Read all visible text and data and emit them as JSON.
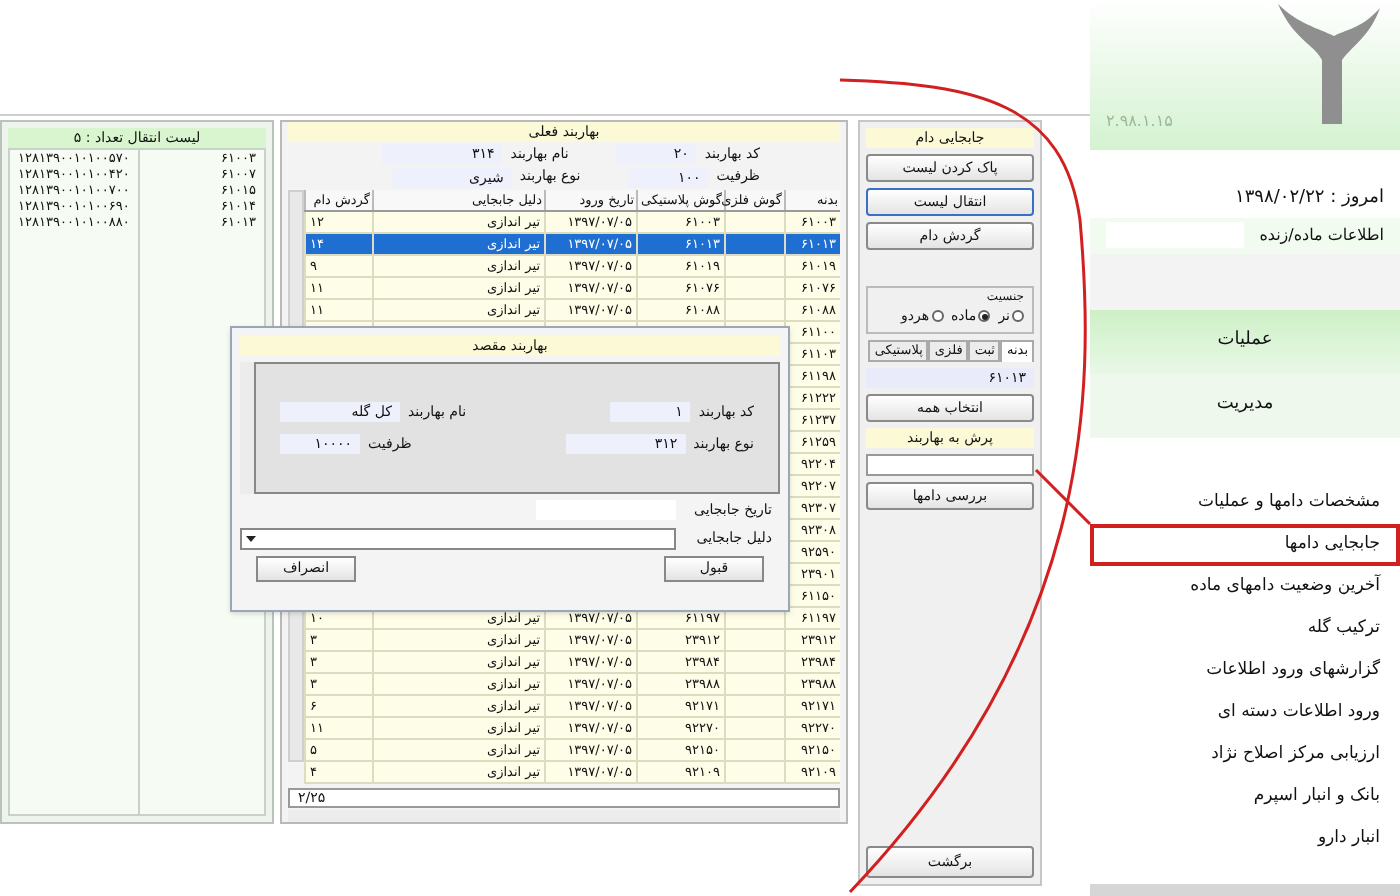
{
  "transfer_list": {
    "title": "لیست انتقال تعداد : ۵",
    "items": [
      {
        "tag": "۶۱۰۰۳",
        "code": "۱۲۸۱۳۹۰۰۱۰۱۰۰۵۷۰"
      },
      {
        "tag": "۶۱۰۰۷",
        "code": "۱۲۸۱۳۹۰۰۱۰۱۰۰۴۲۰"
      },
      {
        "tag": "۶۱۰۱۵",
        "code": "۱۲۸۱۳۹۰۰۱۰۱۰۰۷۰۰"
      },
      {
        "tag": "۶۱۰۱۴",
        "code": "۱۲۸۱۳۹۰۰۱۰۱۰۰۶۹۰"
      },
      {
        "tag": "۶۱۰۱۳",
        "code": "۱۲۸۱۳۹۰۰۱۰۱۰۰۸۸۰"
      }
    ]
  },
  "current_pen": {
    "title": "بهاربند فعلی",
    "fields": [
      {
        "label": "کد بهاربند",
        "value": "۲۰"
      },
      {
        "label": "نام بهاربند",
        "value": "۳۱۴"
      },
      {
        "label": "ظرفیت",
        "value": "۱۰۰"
      },
      {
        "label": "نوع بهاربند",
        "value": "شیری"
      }
    ],
    "table": {
      "columns": [
        "بدنه",
        "گوش فلزی",
        "گوش پلاستیکی",
        "تاریخ ورود",
        "دلیل جابجایی",
        "گردش دام"
      ],
      "rows": [
        {
          "tag": "۶۱۰۰۳",
          "ear_plastic": "۶۱۰۰۳",
          "entry_date": "۱۳۹۷/۰۷/۰۵",
          "reason": "تیر اندازی",
          "turnover": "۱۲",
          "selected": false
        },
        {
          "tag": "۶۱۰۱۳",
          "ear_plastic": "۶۱۰۱۳",
          "entry_date": "۱۳۹۷/۰۷/۰۵",
          "reason": "تیر اندازی",
          "turnover": "۱۴",
          "selected": true
        },
        {
          "tag": "۶۱۰۱۹",
          "ear_plastic": "۶۱۰۱۹",
          "entry_date": "۱۳۹۷/۰۷/۰۵",
          "reason": "تیر اندازی",
          "turnover": "۹",
          "selected": false
        },
        {
          "tag": "۶۱۰۷۶",
          "ear_plastic": "۶۱۰۷۶",
          "entry_date": "۱۳۹۷/۰۷/۰۵",
          "reason": "تیر اندازی",
          "turnover": "۱۱",
          "selected": false
        },
        {
          "tag": "۶۱۰۸۸",
          "ear_plastic": "۶۱۰۸۸",
          "entry_date": "۱۳۹۷/۰۷/۰۵",
          "reason": "تیر اندازی",
          "turnover": "۱۱",
          "selected": false
        },
        {
          "tag": "۶۱۱۰۰",
          "selected": false
        },
        {
          "tag": "۶۱۱۰۳",
          "selected": false
        },
        {
          "tag": "۶۱۱۹۸",
          "selected": false
        },
        {
          "tag": "۶۱۲۲۲",
          "selected": false
        },
        {
          "tag": "۶۱۲۳۷",
          "selected": false
        },
        {
          "tag": "۶۱۲۵۹",
          "selected": false
        },
        {
          "tag": "۹۲۲۰۴",
          "selected": false
        },
        {
          "tag": "۹۲۲۰۷",
          "selected": false
        },
        {
          "tag": "۹۲۳۰۷",
          "selected": false
        },
        {
          "tag": "۹۲۳۰۸",
          "selected": false
        },
        {
          "tag": "۹۲۵۹۰",
          "selected": false
        },
        {
          "tag": "۲۳۹۰۱",
          "selected": false
        },
        {
          "tag": "۶۱۱۵۰",
          "selected": false
        },
        {
          "tag": "۶۱۱۹۷",
          "ear_plastic": "۶۱۱۹۷",
          "entry_date": "۱۳۹۷/۰۷/۰۵",
          "reason": "تیر اندازی",
          "turnover": "۱۰",
          "selected": false
        },
        {
          "tag": "۲۳۹۱۲",
          "ear_plastic": "۲۳۹۱۲",
          "entry_date": "۱۳۹۷/۰۷/۰۵",
          "reason": "تیر اندازی",
          "turnover": "۳",
          "selected": false
        },
        {
          "tag": "۲۳۹۸۴",
          "ear_plastic": "۲۳۹۸۴",
          "entry_date": "۱۳۹۷/۰۷/۰۵",
          "reason": "تیر اندازی",
          "turnover": "۳",
          "selected": false
        },
        {
          "tag": "۲۳۹۸۸",
          "ear_plastic": "۲۳۹۸۸",
          "entry_date": "۱۳۹۷/۰۷/۰۵",
          "reason": "تیر اندازی",
          "turnover": "۳",
          "selected": false
        },
        {
          "tag": "۹۲۱۷۱",
          "ear_plastic": "۹۲۱۷۱",
          "entry_date": "۱۳۹۷/۰۷/۰۵",
          "reason": "تیر اندازی",
          "turnover": "۶",
          "selected": false
        },
        {
          "tag": "۹۲۲۷۰",
          "ear_plastic": "۹۲۲۷۰",
          "entry_date": "۱۳۹۷/۰۷/۰۵",
          "reason": "تیر اندازی",
          "turnover": "۱۱",
          "selected": false
        },
        {
          "tag": "۹۲۱۵۰",
          "ear_plastic": "۹۲۱۵۰",
          "entry_date": "۱۳۹۷/۰۷/۰۵",
          "reason": "تیر اندازی",
          "turnover": "۵",
          "selected": false
        },
        {
          "tag": "۹۲۱۰۹",
          "ear_plastic": "۹۲۱۰۹",
          "entry_date": "۱۳۹۷/۰۷/۰۵",
          "reason": "تیر اندازی",
          "turnover": "۴",
          "selected": false
        }
      ]
    },
    "footer_value": "۲/۲۵"
  },
  "actions": {
    "title": "جابجایی دام",
    "buttons": [
      {
        "label": "پاک کردن لیست",
        "focused": false
      },
      {
        "label": "انتقال لیست",
        "focused": true
      },
      {
        "label": "گردش دام",
        "focused": false
      }
    ],
    "gender": {
      "label": "جنسیت",
      "options": [
        {
          "label": "نر",
          "selected": false
        },
        {
          "label": "ماده",
          "selected": true
        },
        {
          "label": "هردو",
          "selected": false
        }
      ]
    },
    "tabs": [
      {
        "label": "بدنه",
        "selected": true
      },
      {
        "label": "ثبت",
        "selected": false
      },
      {
        "label": "فلزی",
        "selected": false
      },
      {
        "label": "پلاستیکی",
        "selected": false
      }
    ],
    "tag_value": "۶۱۰۱۳",
    "select_all": "انتخاب همه",
    "jump_label": "پرش به بهاربند",
    "check_button": "بررسی دامها",
    "back_button": "برگشت"
  },
  "dialog": {
    "title": "بهاربند مقصد",
    "fields": [
      {
        "label": "کد بهاربند",
        "value": "۱"
      },
      {
        "label": "نام بهاربند",
        "value": "کل گله"
      },
      {
        "label": "نوع بهاربند",
        "value": "۳۱۲"
      },
      {
        "label": "ظرفیت",
        "value": "۱۰۰۰۰"
      }
    ],
    "date_label": "تاریخ جابجایی",
    "reason_label": "دلیل جابجایی",
    "ok": "قبول",
    "cancel": "انصراف"
  },
  "sidebar": {
    "version": "۲.۹۸.۱.۱۵",
    "today": "امروز : ۱۳۹۸/۰۲/۲۲",
    "info_label": "اطلاعات ماده/زنده",
    "sections": [
      "عملیات",
      "مدیریت"
    ],
    "menu": [
      {
        "label": "مشخصات دامها و عملیات",
        "selected": false
      },
      {
        "label": "جابجایی دامها",
        "selected": true
      },
      {
        "label": "آخرین وضعیت دامهای ماده",
        "selected": false
      },
      {
        "label": "ترکیب گله",
        "selected": false
      },
      {
        "label": "گزارشهای ورود اطلاعات",
        "selected": false
      },
      {
        "label": "ورود اطلاعات دسته ای",
        "selected": false
      },
      {
        "label": "ارزیابی مرکز اصلاح نژاد",
        "selected": false
      },
      {
        "label": "بانک و انبار اسپرم",
        "selected": false
      },
      {
        "label": "انبار دارو",
        "selected": false
      }
    ]
  }
}
